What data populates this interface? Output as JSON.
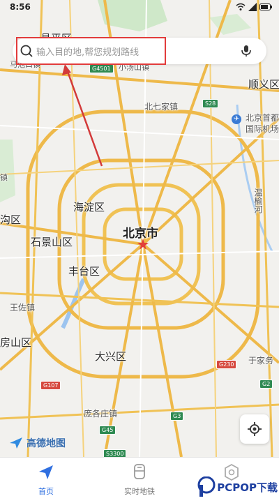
{
  "status": {
    "time": "8:56"
  },
  "search": {
    "placeholder": "输入目的地,帮您规划路线"
  },
  "map": {
    "city": "北京市",
    "districts": [
      "海淀区",
      "石景山区",
      "丰台区",
      "大兴区",
      "顺义区",
      "房山区"
    ],
    "districts_partial": [
      "昌平区",
      "沟区"
    ],
    "towns": [
      "北七家镇",
      "王佐镇",
      "庞各庄镇",
      "于家务",
      "小汤山镇",
      "马池口镇"
    ],
    "airport": [
      "北京首都",
      "国际机场"
    ],
    "river_vertical": "温榆河",
    "misc": [
      "镇"
    ],
    "road_shields": [
      "G4501",
      "S28",
      "G230",
      "G107",
      "G45",
      "S3300",
      "G3",
      "G2"
    ]
  },
  "logo": {
    "text": "高德地图"
  },
  "tabs": [
    {
      "label": "首页",
      "active": true
    },
    {
      "label": "实时地铁",
      "active": false
    },
    {
      "label": "",
      "active": false
    }
  ],
  "watermark": {
    "text": "PCPOP下载"
  },
  "colors": {
    "accent": "#2f6fe0",
    "highlight": "#e23b3b",
    "arrow": "#d33a3a"
  }
}
